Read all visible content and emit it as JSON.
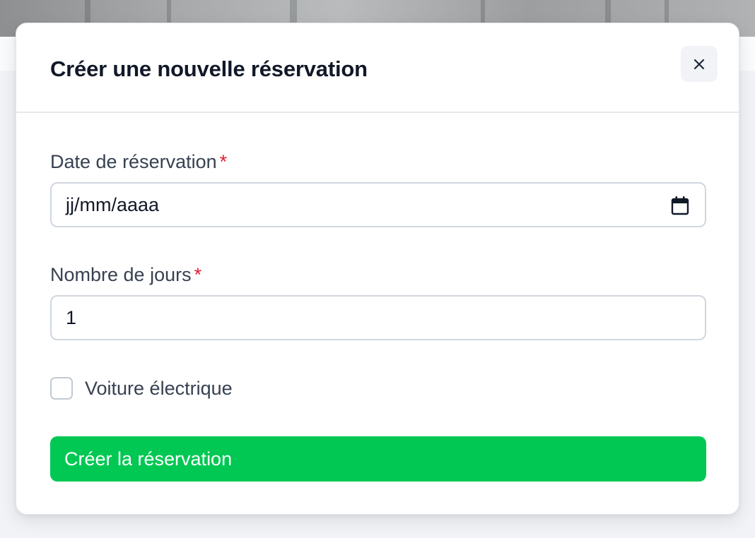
{
  "modal": {
    "title": "Créer une nouvelle réservation",
    "close_icon": "close-icon"
  },
  "form": {
    "date_field": {
      "label": "Date de réservation",
      "required_marker": "*",
      "placeholder": "jj/mm/aaaa",
      "value": "",
      "icon": "calendar-icon"
    },
    "days_field": {
      "label": "Nombre de jours",
      "required_marker": "*",
      "value": "1"
    },
    "electric_checkbox": {
      "label": "Voiture électrique",
      "checked": false
    },
    "submit_label": "Créer la réservation"
  },
  "colors": {
    "accent_green": "#00c853",
    "required_red": "#e11d2e",
    "title_text": "#111827",
    "label_text": "#374151"
  }
}
